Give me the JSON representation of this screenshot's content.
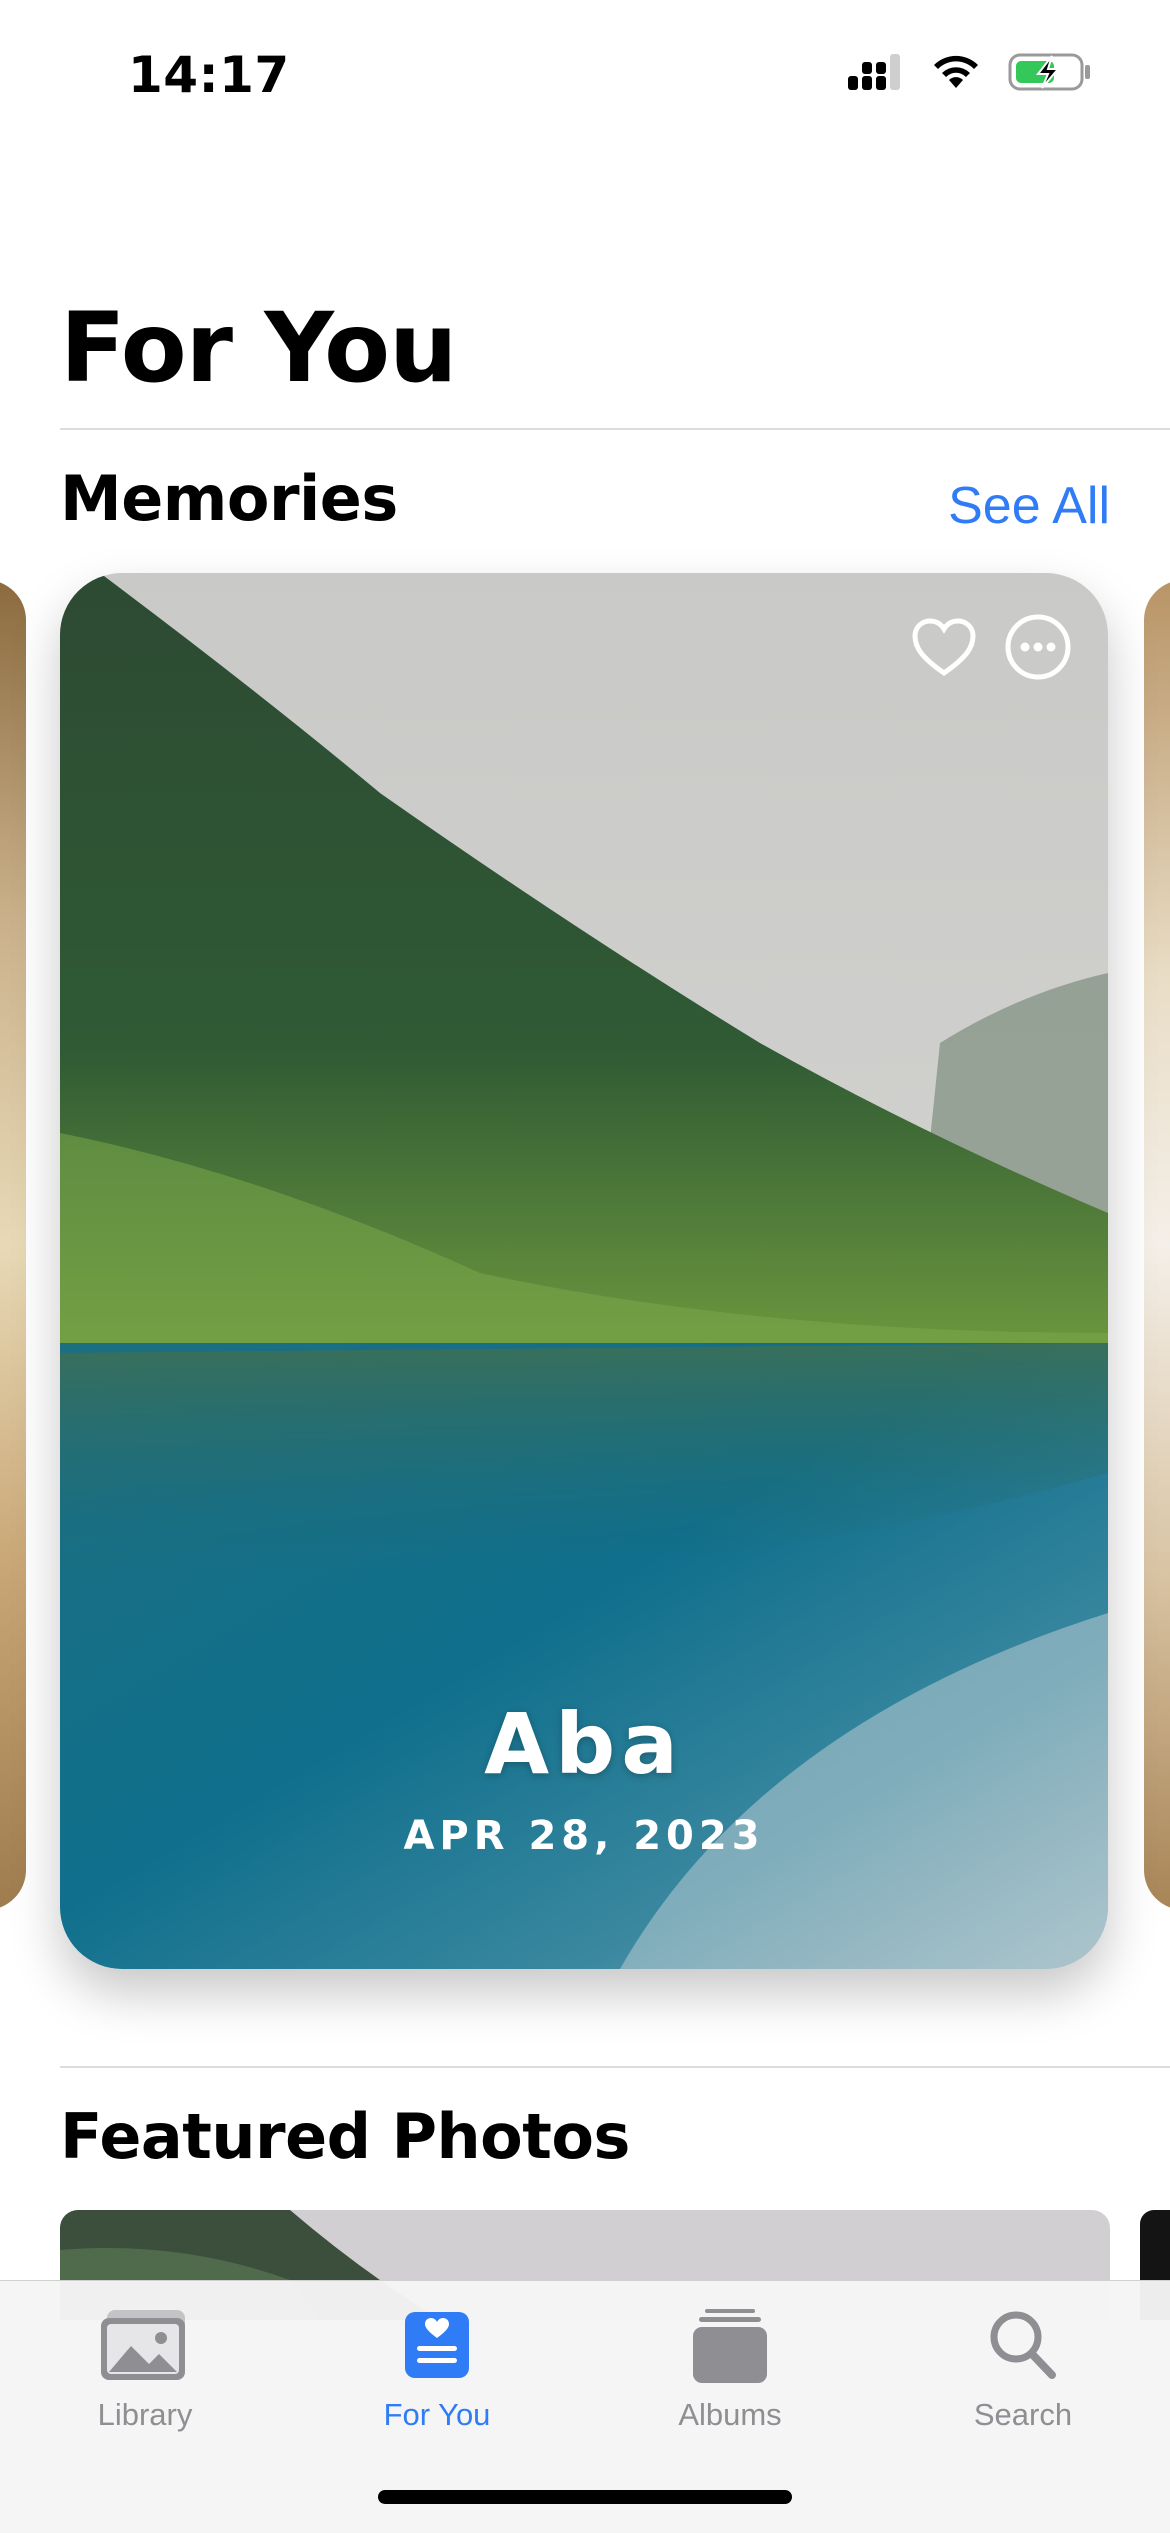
{
  "status_bar": {
    "time": "14:17",
    "icons": [
      "cellular-signal-icon",
      "wifi-icon",
      "battery-charging-icon"
    ]
  },
  "header": {
    "title": "For You"
  },
  "memories": {
    "title": "Memories",
    "see_all_label": "See All",
    "card": {
      "title": "Aba",
      "date": "APR 28, 2023",
      "actions": [
        "heart-icon",
        "more-icon"
      ]
    }
  },
  "featured": {
    "title": "Featured Photos"
  },
  "tab_bar": {
    "tabs": [
      {
        "label": "Library",
        "icon": "photo-library-icon",
        "active": false
      },
      {
        "label": "For You",
        "icon": "for-you-icon",
        "active": true
      },
      {
        "label": "Albums",
        "icon": "albums-icon",
        "active": false
      },
      {
        "label": "Search",
        "icon": "search-icon",
        "active": false
      }
    ]
  },
  "colors": {
    "accent": "#2f7cf6",
    "inactive": "#8e8e93"
  }
}
